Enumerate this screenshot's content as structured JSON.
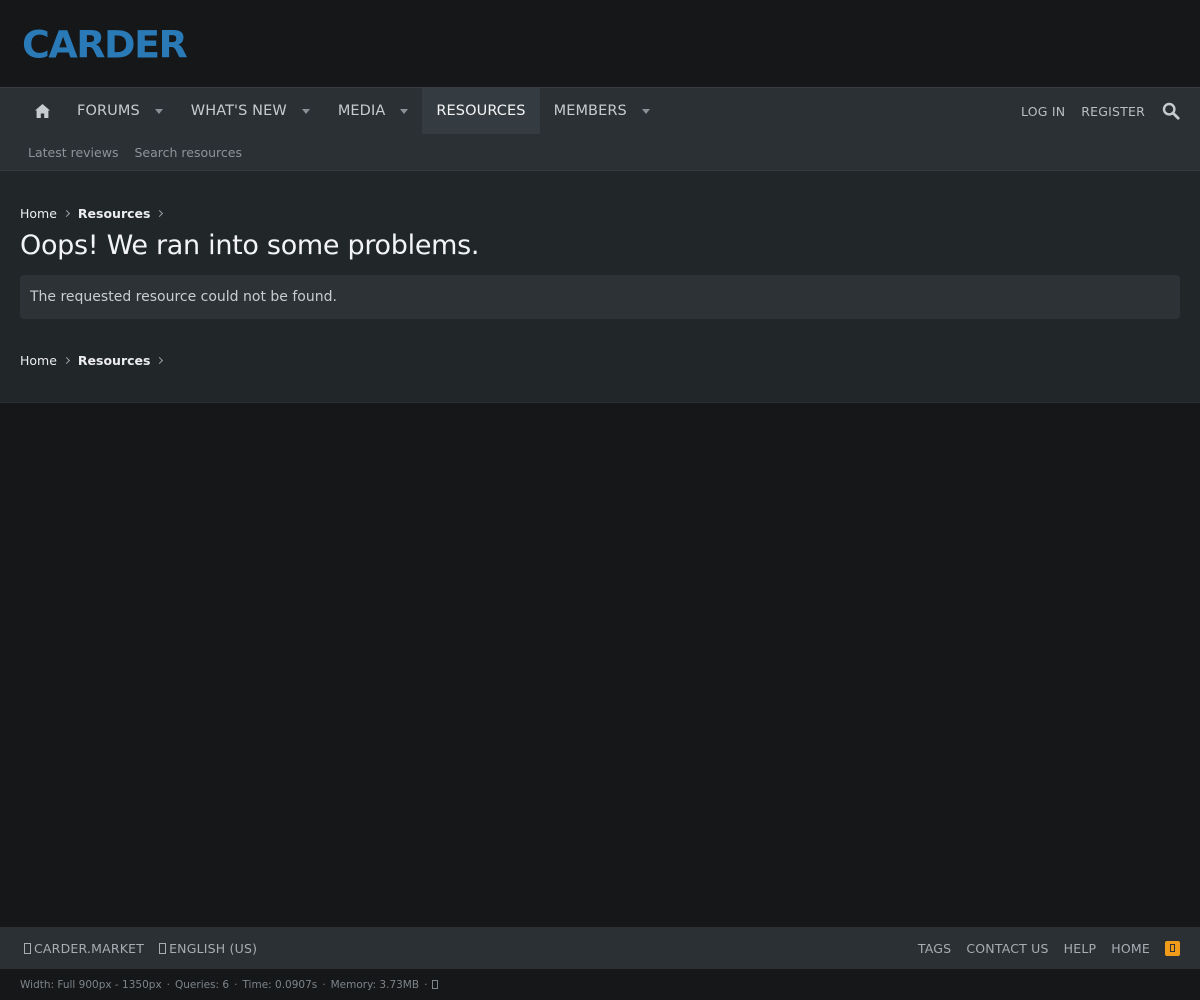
{
  "header": {
    "logo_text": "CARDER"
  },
  "nav": {
    "tabs": [
      {
        "label": "FORUMS"
      },
      {
        "label": "WHAT'S NEW"
      },
      {
        "label": "MEDIA"
      },
      {
        "label": "RESOURCES"
      },
      {
        "label": "MEMBERS"
      }
    ],
    "login_label": "LOG IN",
    "register_label": "REGISTER",
    "home_icon": "home-icon",
    "search_icon": "search-icon"
  },
  "subnav": {
    "links": [
      {
        "label": "Latest reviews"
      },
      {
        "label": "Search resources"
      }
    ]
  },
  "main": {
    "breadcrumb": [
      {
        "label": "Home"
      },
      {
        "label": "Resources"
      }
    ],
    "title": "Oops! We ran into some problems.",
    "notice": "The requested resource could not be found."
  },
  "footer": {
    "style_label": "CARDER.MARKET",
    "language_label": "ENGLISH (US)",
    "links": [
      {
        "label": "TAGS"
      },
      {
        "label": "CONTACT US"
      },
      {
        "label": "HELP"
      },
      {
        "label": "HOME"
      }
    ],
    "debug": {
      "width": "Width: Full 900px - 1350px",
      "queries": "Queries: 6",
      "time": "Time: 0.0907s",
      "memory": "Memory: 3.73MB"
    },
    "rss_icon": "rss-icon"
  },
  "colors": {
    "logo": "#2a7ab8",
    "rss": "#f19b1a",
    "page_bg": "#151719",
    "nav_bg": "#2b3034",
    "content_bg": "#212629"
  }
}
